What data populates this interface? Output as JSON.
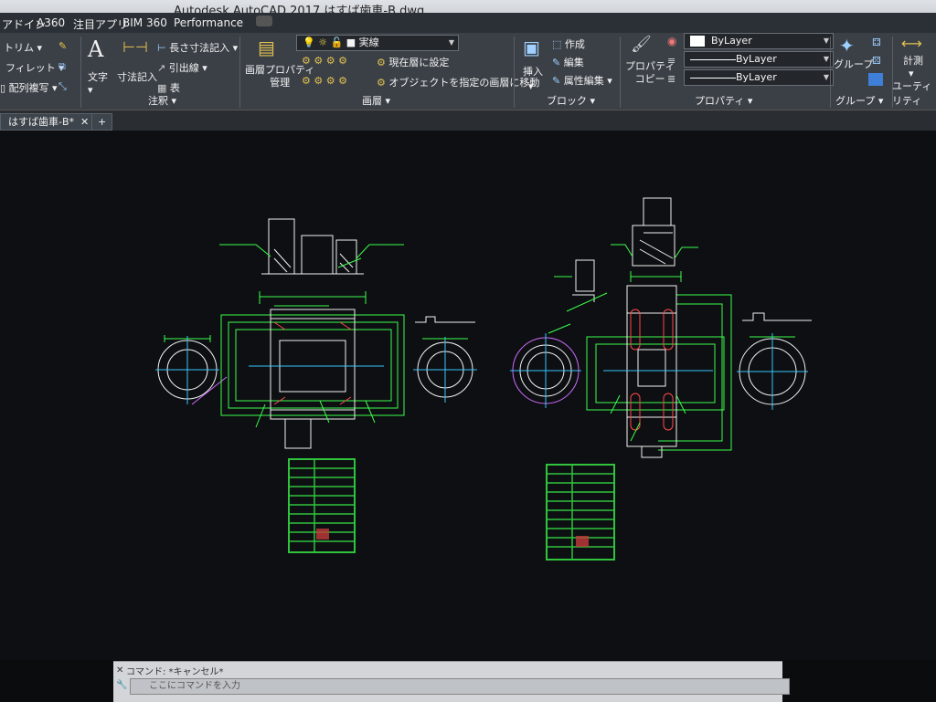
{
  "window": {
    "title": "Autodesk AutoCAD 2017    はすば歯車-B.dwg"
  },
  "ribbon_tabs": [
    "アドイン",
    "A360",
    "注目アプリ",
    "BIM 360",
    "Performance"
  ],
  "ribbon": {
    "modify": {
      "trim": "トリム",
      "fillet": "フィレット",
      "array": "配列複写"
    },
    "annotation": {
      "text": "文字",
      "dimension": "寸法記入",
      "linear": "長さ寸法記入",
      "leader": "引出線",
      "table": "表",
      "panel": "注釈"
    },
    "layers": {
      "properties": "画層プロパティ\n管理",
      "current_layer": "実線",
      "set_current": "現在層に設定",
      "match": "オブジェクトを指定の画層に移動",
      "panel": "画層"
    },
    "block": {
      "insert": "挿入",
      "create": "作成",
      "edit": "編集",
      "attr_edit": "属性編集",
      "panel": "ブロック"
    },
    "properties": {
      "copy": "プロパティ\nコピー",
      "color": "ByLayer",
      "linetype": "ByLayer",
      "lineweight": "ByLayer",
      "panel": "プロパティ"
    },
    "groups": {
      "group": "グループ",
      "panel": "グループ"
    },
    "utilities": {
      "measure": "計測",
      "panel": "ユーティリティ"
    }
  },
  "file_tabs": {
    "active": "はすば歯車-B*",
    "add": "+"
  },
  "command": {
    "history": "コマンド: *キャンセル*",
    "placeholder": "ここにコマンドを入力"
  },
  "colors": {
    "line_green": "#3cff4c",
    "line_white": "#f2f2f2",
    "line_cyan": "#38c6ff",
    "line_magenta": "#d26bff",
    "line_red": "#ff4a4a",
    "line_yellow": "#f5e14a"
  }
}
